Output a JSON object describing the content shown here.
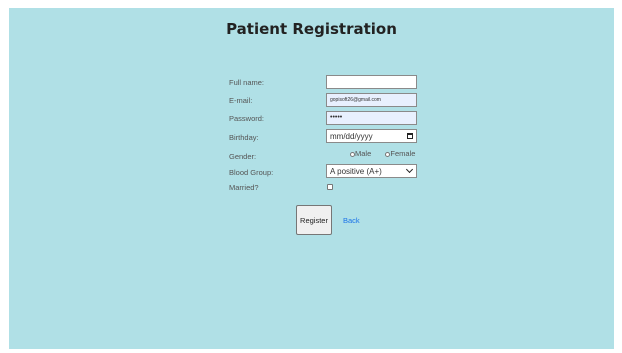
{
  "page": {
    "title": "Patient Registration",
    "background_color": "#b0e0e6"
  },
  "form": {
    "full_name": {
      "label": "Full name:",
      "value": ""
    },
    "email": {
      "label": "E-mail:",
      "value": "gopisoft26@gmail.com"
    },
    "password": {
      "label": "Password:",
      "value": "•••••"
    },
    "birthday": {
      "label": "Birthday:",
      "value": "mm/dd/yyyy",
      "icon": "calendar-icon"
    },
    "gender": {
      "label": "Gender:",
      "options": [
        "Male",
        "Female"
      ]
    },
    "blood_group": {
      "label": "Blood Group:",
      "selected": "A positive (A+)",
      "icon": "chevron-down-icon"
    },
    "married": {
      "label": "Married?",
      "checked": false
    }
  },
  "actions": {
    "register_label": "Register",
    "back_label": "Back",
    "link_color": "#1a73e8"
  }
}
